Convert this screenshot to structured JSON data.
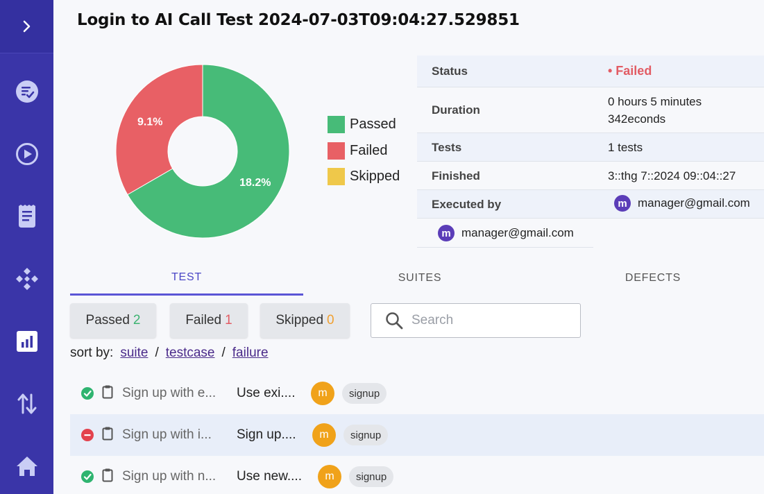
{
  "page": {
    "title": "Login to AI Call Test 2024-07-03T09:04:27.529851"
  },
  "sidebar": {
    "items": [
      {
        "name": "expand",
        "icon": "chevron-right-icon"
      },
      {
        "name": "tests",
        "icon": "checklist-icon"
      },
      {
        "name": "runs",
        "icon": "play-circle-icon"
      },
      {
        "name": "reports",
        "icon": "receipt-icon"
      },
      {
        "name": "plans",
        "icon": "diamond-grid-icon"
      },
      {
        "name": "analytics",
        "icon": "bar-chart-icon"
      },
      {
        "name": "sync",
        "icon": "swap-vertical-icon"
      },
      {
        "name": "home",
        "icon": "home-icon"
      }
    ]
  },
  "chart_data": {
    "type": "pie",
    "donut": true,
    "categories": [
      "Passed",
      "Failed",
      "Skipped"
    ],
    "values": [
      2,
      1,
      0
    ],
    "slice_labels": [
      "18.2%",
      "9.1%",
      ""
    ],
    "colors": [
      "#47bb78",
      "#e86065",
      "#efc84a"
    ],
    "legend_position": "right"
  },
  "info": {
    "status_label": "Status",
    "status_value": "• Failed",
    "duration_label": "Duration",
    "duration_value_line1": "0 hours 5 minutes",
    "duration_value_line2": "342econds",
    "tests_label": "Tests",
    "tests_value": "1 tests",
    "finished_label": "Finished",
    "finished_value": "3::thg 7::2024 09::04::27",
    "executed_label": "Executed by",
    "executed_avatar": "m",
    "executed_value": "manager@gmail.com",
    "executed_value_2": "manager@gmail.com"
  },
  "tabs": [
    {
      "label": "TEST",
      "active": true
    },
    {
      "label": "SUITES",
      "active": false
    },
    {
      "label": "DEFECTS",
      "active": false
    }
  ],
  "filters": {
    "passed_label": "Passed",
    "passed_count": "2",
    "failed_label": "Failed",
    "failed_count": "1",
    "skipped_label": "Skipped",
    "skipped_count": "0"
  },
  "search": {
    "placeholder": "Search"
  },
  "sort": {
    "label": "sort by:",
    "options": [
      "suite",
      "testcase",
      "failure"
    ],
    "separator": "/"
  },
  "rows": [
    {
      "status": "passed",
      "title": "Sign up with e...",
      "desc": "Use exi....",
      "avatar": "m",
      "tag": "signup"
    },
    {
      "status": "failed",
      "title": "Sign up with i...",
      "desc": "Sign up....",
      "avatar": "m",
      "tag": "signup"
    },
    {
      "status": "passed",
      "title": "Sign up with n...",
      "desc": "Use new....",
      "avatar": "m",
      "tag": "signup"
    }
  ]
}
